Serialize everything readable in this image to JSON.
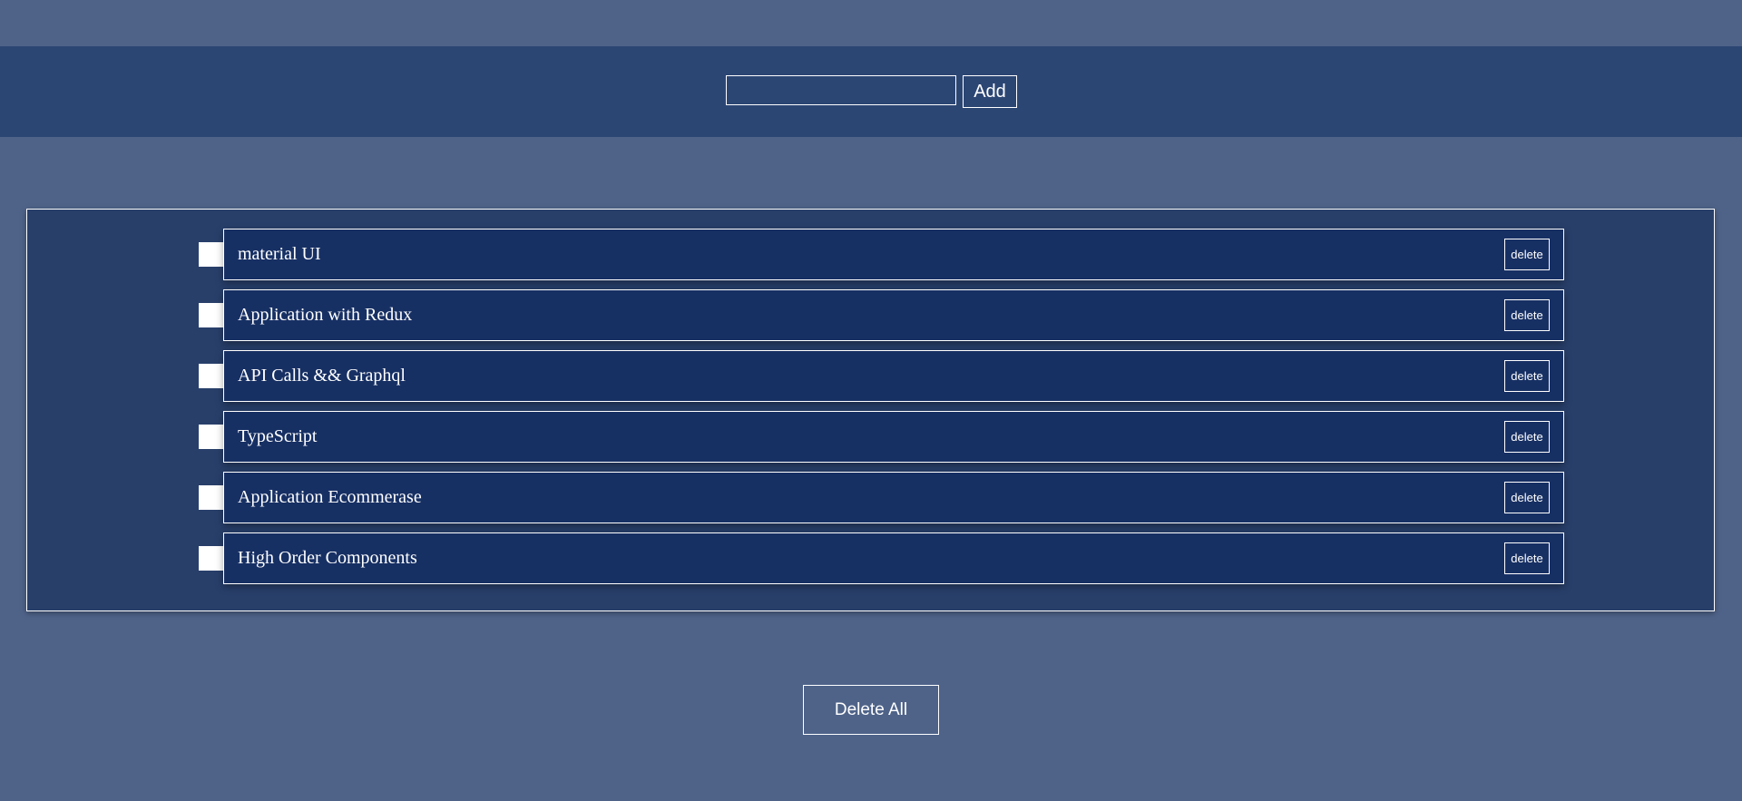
{
  "colors": {
    "page_background": "#4f6389",
    "top_bar": "#2c4674",
    "panel": "#283f6a",
    "item": "#173064",
    "foreground": "#ffffff"
  },
  "add_form": {
    "input_value": "",
    "button_label": "Add"
  },
  "todos": [
    {
      "text": "material UI",
      "checked": false,
      "delete_label": "delete"
    },
    {
      "text": "Application with Redux",
      "checked": false,
      "delete_label": "delete"
    },
    {
      "text": "API Calls && Graphql",
      "checked": false,
      "delete_label": "delete"
    },
    {
      "text": "TypeScript",
      "checked": false,
      "delete_label": "delete"
    },
    {
      "text": "Application Ecommerase",
      "checked": false,
      "delete_label": "delete"
    },
    {
      "text": "High Order Components",
      "checked": false,
      "delete_label": "delete"
    }
  ],
  "footer": {
    "delete_all_label": "Delete All"
  }
}
